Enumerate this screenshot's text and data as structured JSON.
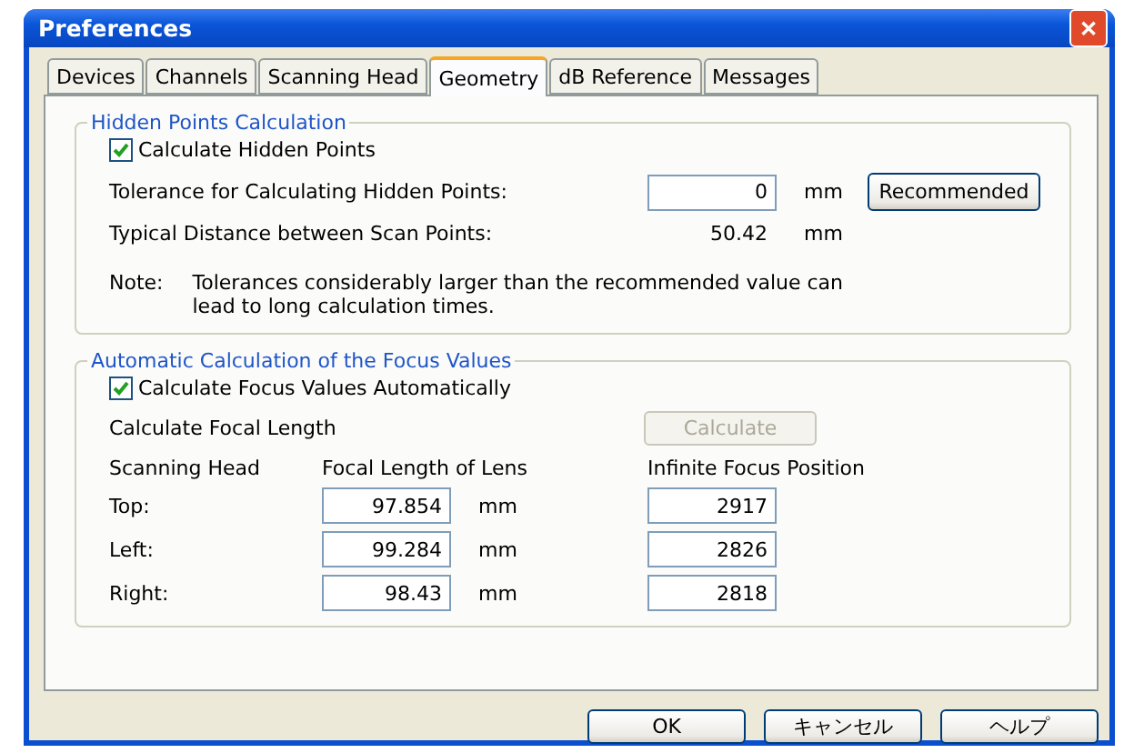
{
  "window": {
    "title": "Preferences",
    "close_icon": "✕"
  },
  "tabs": [
    {
      "label": "Devices",
      "selected": false
    },
    {
      "label": "Channels",
      "selected": false
    },
    {
      "label": "Scanning Head",
      "selected": false
    },
    {
      "label": "Geometry",
      "selected": true
    },
    {
      "label": "dB Reference",
      "selected": false
    },
    {
      "label": "Messages",
      "selected": false
    }
  ],
  "hidden_points": {
    "title": "Hidden Points Calculation",
    "checkbox": {
      "label": "Calculate Hidden Points",
      "checked": true
    },
    "tolerance": {
      "label": "Tolerance for Calculating Hidden Points:",
      "value": "0",
      "unit": "mm",
      "button": "Recommended"
    },
    "typical_distance": {
      "label": "Typical Distance between Scan Points:",
      "value": "50.42",
      "unit": "mm"
    },
    "note": {
      "label": "Note:",
      "text": "Tolerances considerably larger than the recommended value can lead to long calculation times."
    }
  },
  "focus": {
    "title": "Automatic Calculation of the Focus Values",
    "checkbox": {
      "label": "Calculate Focus Values Automatically",
      "checked": true
    },
    "focal_length_label": "Calculate Focal Length",
    "calculate_button": {
      "label": "Calculate",
      "disabled": true
    },
    "columns": [
      "Scanning Head",
      "Focal Length of Lens",
      "Infinite Focus Position"
    ],
    "rows": [
      {
        "head": "Top:",
        "focal_length": "97.854",
        "unit": "mm",
        "infinite_focus": "2917"
      },
      {
        "head": "Left:",
        "focal_length": "99.284",
        "unit": "mm",
        "infinite_focus": "2826"
      },
      {
        "head": "Right:",
        "focal_length": "98.43",
        "unit": "mm",
        "infinite_focus": "2818"
      }
    ]
  },
  "buttons": [
    "OK",
    "キャンセル",
    "ヘルプ"
  ]
}
